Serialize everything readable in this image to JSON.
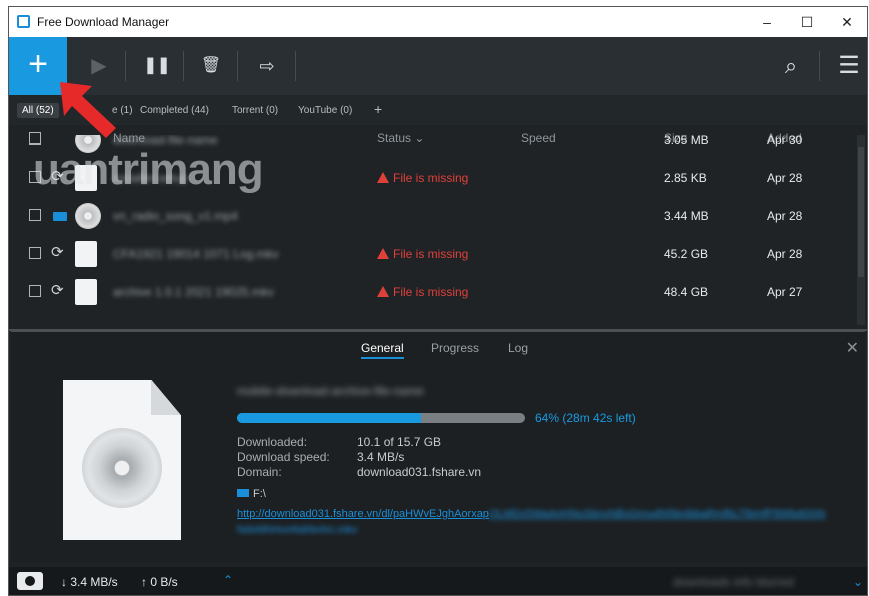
{
  "window": {
    "title": "Free Download Manager",
    "minimize": "–",
    "maximize": "☐",
    "close": "✕"
  },
  "toolbar": {
    "add": "+",
    "start": "▶",
    "pause": "❚❚",
    "delete": "🗑",
    "move": "⇨",
    "search": "⌕",
    "menu": "☰"
  },
  "filters": [
    {
      "label": "All (52)",
      "active": true
    },
    {
      "label": "e (1)",
      "active": false
    },
    {
      "label": "Completed (44)",
      "active": false
    },
    {
      "label": "Torrent (0)",
      "active": false
    },
    {
      "label": "YouTube (0)",
      "active": false
    },
    {
      "label": "+",
      "active": false
    }
  ],
  "columns": {
    "name": "Name",
    "status": "Status ⌄",
    "speed": "Speed",
    "size": "Size",
    "added": "Added"
  },
  "rows": [
    {
      "name": "download-file-name",
      "status": "",
      "size": "3.05 MB",
      "added": "Apr 30",
      "control": "",
      "icon": "disc-icon"
    },
    {
      "name": "installer-setup",
      "status": "File is missing",
      "size": "2.85 KB",
      "added": "Apr 28",
      "control": "⟳",
      "icon": "gear-file-icon"
    },
    {
      "name": "vn_radio_song_v1.mp4",
      "status": "",
      "size": "3.44 MB",
      "added": "Apr 28",
      "control": "",
      "icon": "disc-icon"
    },
    {
      "name": "CFA1921 19014 1071 Log.mkv",
      "status": "File is missing",
      "size": "45.2 GB",
      "added": "Apr 28",
      "control": "⟳",
      "icon": "file-icon"
    },
    {
      "name": "archive 1.0.1 2021 19025.mkv",
      "status": "File is missing",
      "size": "48.4 GB",
      "added": "Apr 27",
      "control": "⟳",
      "icon": "file-icon"
    }
  ],
  "watermark": "uantrimang",
  "detail": {
    "tabs": [
      "General",
      "Progress",
      "Log"
    ],
    "close": "✕",
    "file_name": "mobile-download-archive-file-name",
    "progress_fraction": 0.64,
    "progress_text": "64% (28m 42s left)",
    "downloaded_label": "Downloaded:",
    "downloaded_value": "10.1 of 15.7 GB",
    "speed_label": "Download speed:",
    "speed_value": "3.4 MB/s",
    "domain_label": "Domain:",
    "domain_value": "download031.fshare.vn",
    "folder": "F:\\",
    "url_visible": "http://download031.fshare.vn/dl/paHWvEJghAorxap",
    "url_blurred": "QLMDx5WaAnHNuSbnxNBxGmudN5bnibbaRmfbLTtbmfP8WbdGhN",
    "url_line2": "NdxMhHunNdrbnhn.mkv"
  },
  "statusbar": {
    "down": "↓ 3.4 MB/s",
    "up": "↑ 0 B/s",
    "chevron": "⌃",
    "right_info": "downloads info blurred",
    "right_chevron": "⌄"
  }
}
